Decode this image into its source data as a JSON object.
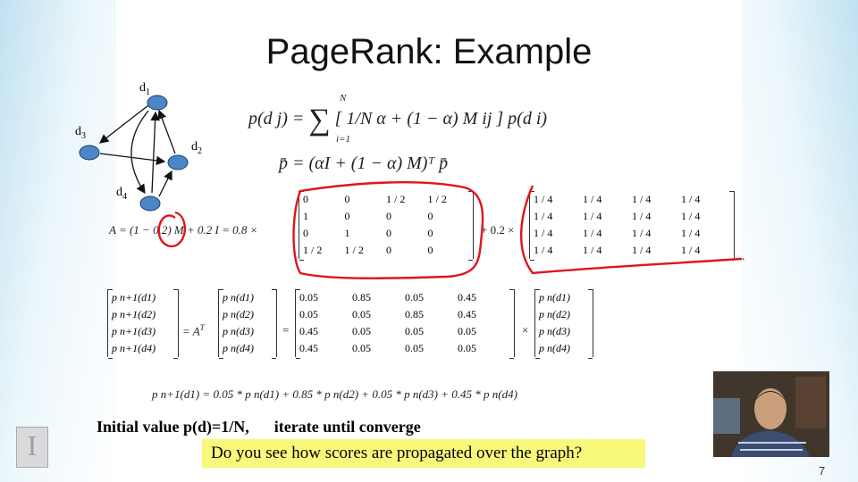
{
  "slide": {
    "title": "PageRank: Example",
    "page_number": "7"
  },
  "graph": {
    "nodes": [
      "d1",
      "d2",
      "d3",
      "d4"
    ],
    "node_labels": {
      "d1": {
        "base": "d",
        "sub": "1"
      },
      "d2": {
        "base": "d",
        "sub": "2"
      },
      "d3": {
        "base": "d",
        "sub": "3"
      },
      "d4": {
        "base": "d",
        "sub": "4"
      }
    },
    "node_color": "#4a86c8"
  },
  "equations": {
    "eq1_lhs": "p(d j) = ",
    "eq1_sigma_top": "N",
    "eq1_sigma_bottom": "i=1",
    "eq1_rhs": "[ 1/N α + (1 − α) M ij ] p(d i)",
    "eq2": "p̄ = (αI + (1 − α) M)ᵀ p̄",
    "a_def": "A = (1 − 0.2) M  + 0.2 I = 0.8 ×",
    "plus": "+ 0.2 ×",
    "period": ".",
    "at_label": "= A",
    "at_sup": "T",
    "equals": "=",
    "times": "×",
    "long_eq": "p n+1(d1) = 0.05 * p n(d1) + 0.85 * p n(d2) + 0.05 * p n(d3) + 0.45 * p n(d4)"
  },
  "matrix_M": [
    [
      "0",
      "0",
      "1 / 2",
      "1 / 2"
    ],
    [
      "1",
      "0",
      "0",
      "0"
    ],
    [
      "0",
      "1",
      "0",
      "0"
    ],
    [
      "1 / 2",
      "1 / 2",
      "0",
      "0"
    ]
  ],
  "matrix_uniform": [
    [
      "1 / 4",
      "1 / 4",
      "1 / 4",
      "1 / 4"
    ],
    [
      "1 / 4",
      "1 / 4",
      "1 / 4",
      "1 / 4"
    ],
    [
      "1 / 4",
      "1 / 4",
      "1 / 4",
      "1 / 4"
    ],
    [
      "1 / 4",
      "1 / 4",
      "1 / 4",
      "1 / 4"
    ]
  ],
  "matrix_AT": [
    [
      "0.05",
      "0.85",
      "0.05",
      "0.45"
    ],
    [
      "0.05",
      "0.05",
      "0.85",
      "0.45"
    ],
    [
      "0.45",
      "0.05",
      "0.05",
      "0.05"
    ],
    [
      "0.45",
      "0.05",
      "0.05",
      "0.05"
    ]
  ],
  "vector_next": [
    "p n+1(d1)",
    "p n+1(d2)",
    "p n+1(d3)",
    "p n+1(d4)"
  ],
  "vector_cur": [
    "p n(d1)",
    "p n(d2)",
    "p n(d3)",
    "p n(d4)"
  ],
  "notes": {
    "initial_part1": "Initial value p(d)=1/N,",
    "initial_part2": "iterate until converge"
  },
  "caption": {
    "text": "Do you see how scores are propagated over the graph?",
    "background": "#f8f87a"
  },
  "annotation_color": "#e0141c"
}
